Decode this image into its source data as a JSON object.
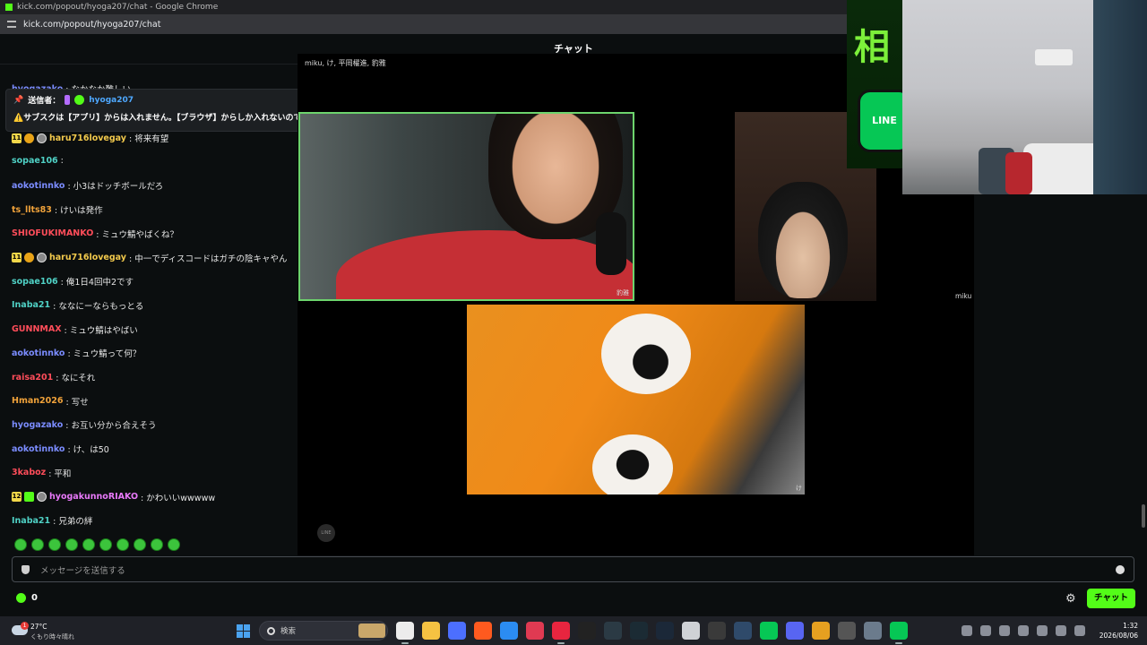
{
  "browser": {
    "window_title": "kick.com/popout/hyoga207/chat - Google Chrome",
    "url": "kick.com/popout/hyoga207/chat"
  },
  "chat": {
    "header_title": "チャット",
    "pinned": {
      "sender_label": "送信者：",
      "sender": "hyoga207",
      "text": "⚠️サブスクは【アプリ】からは入れません。【ブラウザ】からしか入れないので"
    },
    "partial_message": {
      "user": "hyogazako",
      "text": ": なかなか難しい"
    },
    "messages": [
      {
        "badges": [
          "11",
          "gift",
          "og"
        ],
        "user": "haru716lovegay",
        "color": "#f2c94c",
        "text": ": 将来有望"
      },
      {
        "badges": [],
        "user": "sopae106",
        "color": "#4fd1c5",
        "text": ": "
      },
      {
        "badges": [],
        "user": "aokotinnko",
        "color": "#7b8cff",
        "text": ": 小3はドッチボールだろ"
      },
      {
        "badges": [],
        "user": "ts_llts83",
        "color": "#f0a23a",
        "text": ": けいは発作"
      },
      {
        "badges": [],
        "user": "SHIOFUKIMANKO",
        "color": "#ff4d5a",
        "text": ": ミュウ鯖やばくね？"
      },
      {
        "badges": [
          "11",
          "gift",
          "og"
        ],
        "user": "haru716lovegay",
        "color": "#f2c94c",
        "text": ": 中一でディスコードはガチの陰キャやん"
      },
      {
        "badges": [],
        "user": "sopae106",
        "color": "#4fd1c5",
        "text": ": 俺1日4回中2です"
      },
      {
        "badges": [],
        "user": "Inaba21",
        "color": "#4fd1c5",
        "text": ": ななにーならもっとる"
      },
      {
        "badges": [],
        "user": "GUNNMAX",
        "color": "#ff4d5a",
        "text": ": ミュウ鯖はやばい"
      },
      {
        "badges": [],
        "user": "aokotinnko",
        "color": "#7b8cff",
        "text": ": ミュウ鯖って何？"
      },
      {
        "badges": [],
        "user": "raisa201",
        "color": "#ff4d5a",
        "text": ": なにそれ"
      },
      {
        "badges": [],
        "user": "Hman2026",
        "color": "#f0a23a",
        "text": ": 写せ"
      },
      {
        "badges": [],
        "user": "hyogazako",
        "color": "#7b8cff",
        "text": ": お互い分から合えそう"
      },
      {
        "badges": [],
        "user": "aokotinnko",
        "color": "#7b8cff",
        "text": ": け、は50"
      },
      {
        "badges": [],
        "user": "3kaboz",
        "color": "#ff4d5a",
        "text": ": 平和"
      },
      {
        "badges": [
          "12",
          "green",
          "og"
        ],
        "user": "hyogakunnoRIAKO",
        "color": "#e879f9",
        "text": ": かわいいwwwww"
      },
      {
        "badges": [],
        "user": "Inaba21",
        "color": "#4fd1c5",
        "text": ": 兄弟の絆"
      }
    ],
    "input_placeholder": "メッセージを送信する",
    "viewer_count": "0",
    "send_button": "チャット"
  },
  "call": {
    "participants_title": "miku, け, 平岡櫂進, 豹雅",
    "tile_names": {
      "main": "豹雅",
      "second": "miku",
      "third": "け"
    },
    "small_logo": "LINE"
  },
  "overlay": {
    "banner_text": "相",
    "line_logo": "LINE"
  },
  "taskbar": {
    "weather_temp": "27°C",
    "weather_desc": "くもり時々晴れ",
    "weather_badge": "1",
    "search_label": "検索",
    "time": "1:32",
    "date": "2026/08/06",
    "app_colors": [
      "#ececec",
      "#f5c242",
      "#4c6fff",
      "#ff5a1f",
      "#2b8cf2",
      "#e03a52",
      "#e8253f",
      "#222222",
      "#2b3a44",
      "#1b2b34",
      "#1b2838",
      "#cfd2d6",
      "#3a3a3a",
      "#2f4a6a",
      "#06c755",
      "#5865f2",
      "#e6a020",
      "#555555",
      "#6b7b8c",
      "#06c755"
    ]
  }
}
